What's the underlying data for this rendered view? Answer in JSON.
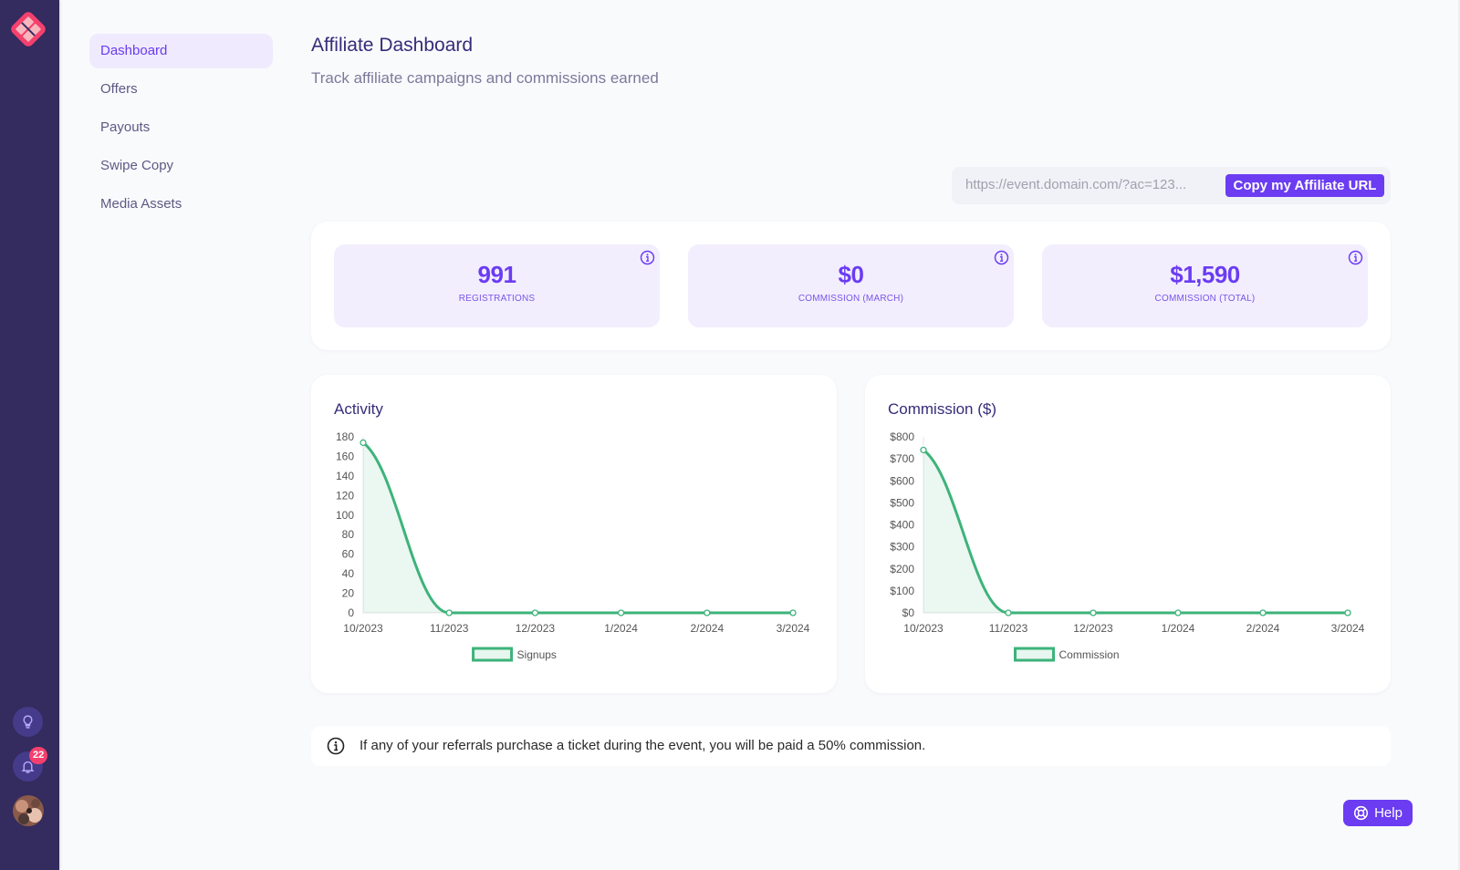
{
  "app": {
    "notifications_count": "22"
  },
  "rail": {
    "icons": [
      "logo-icon",
      "lightbulb-icon",
      "bell-icon",
      "avatar"
    ]
  },
  "nav": {
    "items": [
      {
        "label": "Dashboard",
        "active": true
      },
      {
        "label": "Offers",
        "active": false
      },
      {
        "label": "Payouts",
        "active": false
      },
      {
        "label": "Swipe Copy",
        "active": false
      },
      {
        "label": "Media Assets",
        "active": false
      }
    ]
  },
  "header": {
    "title": "Affiliate Dashboard",
    "subtitle": "Track affiliate campaigns and commissions earned"
  },
  "affiliate_url": {
    "value": "https://event.domain.com/?ac=123...",
    "button_label": "Copy my Affiliate URL"
  },
  "stats": [
    {
      "value": "991",
      "label": "Registrations"
    },
    {
      "value": "$0",
      "label": "Commission (March)"
    },
    {
      "value": "$1,590",
      "label": "Commission (Total)"
    }
  ],
  "notice": {
    "text": "If any of your referrals purchase a ticket during the event, you will be paid a 50% commission."
  },
  "help": {
    "label": "Help"
  },
  "colors": {
    "accent": "#6b3cf2",
    "rail": "#342b5e",
    "series": "#3db37a",
    "badge": "#f5406e"
  },
  "chart_data": [
    {
      "type": "area",
      "title": "Activity",
      "categories": [
        "10/2023",
        "11/2023",
        "12/2023",
        "1/2024",
        "2/2024",
        "3/2024"
      ],
      "series": [
        {
          "name": "Signups",
          "values": [
            174,
            0,
            0,
            0,
            0,
            0
          ]
        }
      ],
      "yticks": [
        "0",
        "20",
        "40",
        "60",
        "80",
        "100",
        "120",
        "140",
        "160",
        "180"
      ],
      "ylim": [
        0,
        180
      ],
      "xlabel": "",
      "ylabel": "",
      "grid": false,
      "legend": "bottom-center"
    },
    {
      "type": "area",
      "title": "Commission ($)",
      "categories": [
        "10/2023",
        "11/2023",
        "12/2023",
        "1/2024",
        "2/2024",
        "3/2024"
      ],
      "series": [
        {
          "name": "Commission",
          "values": [
            740,
            0,
            0,
            0,
            0,
            0
          ]
        }
      ],
      "yticks": [
        "$0",
        "$100",
        "$200",
        "$300",
        "$400",
        "$500",
        "$600",
        "$700",
        "$800"
      ],
      "ylim": [
        0,
        800
      ],
      "xlabel": "",
      "ylabel": "",
      "grid": false,
      "legend": "bottom-center"
    }
  ]
}
